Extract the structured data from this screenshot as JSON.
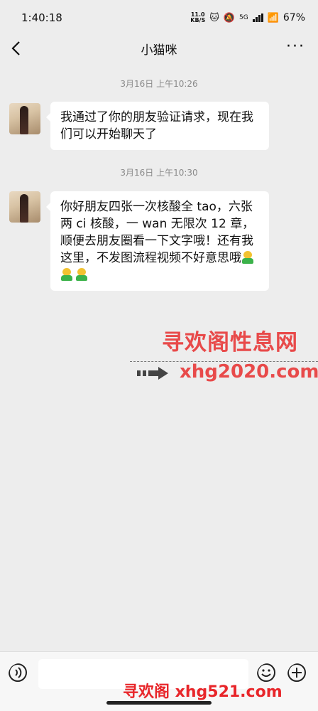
{
  "status_bar": {
    "time": "1:40:18",
    "net_speed_top": "11.0",
    "net_speed_unit": "KB/S",
    "network_type": "5G",
    "battery": "67%"
  },
  "nav": {
    "title": "小猫咪"
  },
  "messages": [
    {
      "time": "3月16日 上午10:26",
      "text": "我通过了你的朋友验证请求，现在我们可以开始聊天了"
    },
    {
      "time": "3月16日 上午10:30",
      "text": "你好朋友四张一次核酸全 tao，六张两 ci 核酸，一 wan 无限次 12 章，顺便去朋友圈看一下文字哦！还有我这里，不发图流程视频不好意思哦"
    }
  ],
  "watermark": {
    "text": "寻欢阁性息网",
    "url": "xhg2020.com",
    "bottom": "寻欢阁 xhg521.com"
  },
  "icons": {
    "back": "back-arrow-icon",
    "more": "more-dots-icon",
    "voice": "voice-icon",
    "emoji": "emoji-icon",
    "plus": "plus-icon"
  },
  "colors": {
    "background": "#ededed",
    "bubble": "#ffffff",
    "watermark": "#e84a4a"
  }
}
